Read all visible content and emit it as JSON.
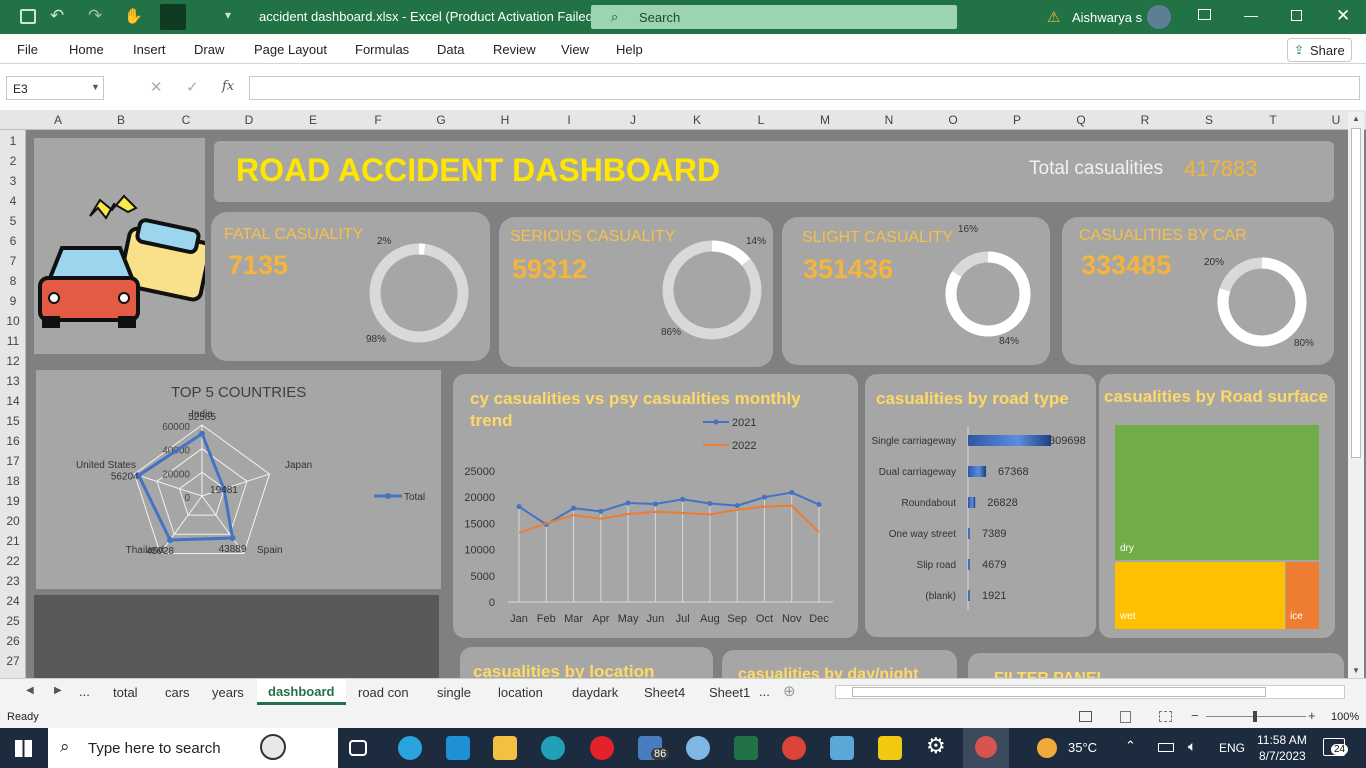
{
  "window": {
    "title": "accident dashboard.xlsx  -  Excel (Product Activation Failed)",
    "search": "Search",
    "user": "Aishwarya s"
  },
  "menu": [
    "File",
    "Home",
    "Insert",
    "Draw",
    "Page Layout",
    "Formulas",
    "Data",
    "Review",
    "View",
    "Help"
  ],
  "share": "Share",
  "name_box": "E3",
  "fx": "fx",
  "columns": [
    "A",
    "B",
    "C",
    "D",
    "E",
    "F",
    "G",
    "H",
    "I",
    "J",
    "K",
    "L",
    "M",
    "N",
    "O",
    "P",
    "Q",
    "R",
    "S",
    "T",
    "U"
  ],
  "rows": [
    "1",
    "2",
    "3",
    "4",
    "5",
    "6",
    "7",
    "8",
    "9",
    "10",
    "11",
    "12",
    "13",
    "14",
    "15",
    "16",
    "17",
    "18",
    "19",
    "20",
    "21",
    "22",
    "23",
    "24",
    "25",
    "26",
    "27"
  ],
  "dashboard": {
    "title": "ROAD ACCIDENT DASHBOARD",
    "total_label": "Total casualities",
    "total_value": "417883",
    "kpis": [
      {
        "label": "FATAL CASUALITY",
        "value": "7135",
        "pct_small": "2%",
        "pct_big": "98%",
        "fraction": 0.02
      },
      {
        "label": "SERIOUS CASUALITY",
        "value": "59312",
        "pct_small": "14%",
        "pct_big": "86%",
        "fraction": 0.14
      },
      {
        "label": "SLIGHT CASUALITY",
        "value": "351436",
        "pct_small": "16%",
        "pct_big": "84%",
        "fraction": 0.84
      },
      {
        "label": "CASUALITIES BY CAR",
        "value": "333485",
        "pct_small": "20%",
        "pct_big": "80%",
        "fraction": 0.8
      }
    ],
    "bottom_titles": [
      "casualities by location",
      "casualities by day/night",
      "FILTER PANEL"
    ]
  },
  "chart_data": [
    {
      "type": "radar",
      "title": "TOP 5 COUNTRIES",
      "categories": [
        "India",
        "Japan",
        "Spain",
        "Thailand",
        "United States"
      ],
      "values": [
        52565,
        19481,
        43889,
        45928,
        56204
      ],
      "ticks": [
        "60000",
        "40000",
        "20000",
        "0"
      ],
      "legend": "Total"
    },
    {
      "type": "line",
      "title": "cy casualities vs psy casualities monthly trend",
      "categories": [
        "Jan",
        "Feb",
        "Mar",
        "Apr",
        "May",
        "Jun",
        "Jul",
        "Aug",
        "Sep",
        "Oct",
        "Nov",
        "Dec"
      ],
      "series": [
        {
          "name": "2021",
          "values": [
            18200,
            14800,
            17900,
            17300,
            18900,
            18700,
            19600,
            18800,
            18400,
            20000,
            20900,
            18600
          ],
          "color": "#4472c4"
        },
        {
          "name": "2022",
          "values": [
            13200,
            15000,
            16600,
            15900,
            16800,
            17200,
            17000,
            16700,
            17600,
            18200,
            18400,
            13300
          ],
          "color": "#ed7d31"
        }
      ],
      "yticks": [
        "25000",
        "20000",
        "15000",
        "10000",
        "5000",
        "0"
      ],
      "ylim": [
        0,
        25000
      ]
    },
    {
      "type": "bar",
      "title": "casualities by road type",
      "categories": [
        "Single carriageway",
        "Dual carriageway",
        "Roundabout",
        "One way street",
        "Slip road",
        "(blank)"
      ],
      "values": [
        309698,
        67368,
        26828,
        7389,
        4679,
        1921
      ]
    },
    {
      "type": "treemap",
      "title": "casualities by Road surface",
      "categories": [
        "dry",
        "wet",
        "ice"
      ],
      "colors": [
        "#70ad47",
        "#ffc000",
        "#ed7d31"
      ]
    }
  ],
  "sheets": [
    "total",
    "cars",
    "years",
    "dashboard",
    "road con",
    "single",
    "location",
    "daydark",
    "Sheet4",
    "Sheet1"
  ],
  "status": {
    "ready": "Ready",
    "zoom": "100%"
  },
  "taskbar": {
    "search": "Type here to search",
    "badge": "86",
    "weather": "35°C",
    "lang": "ENG",
    "time": "11:58 AM",
    "date": "8/7/2023",
    "notif": "24"
  }
}
